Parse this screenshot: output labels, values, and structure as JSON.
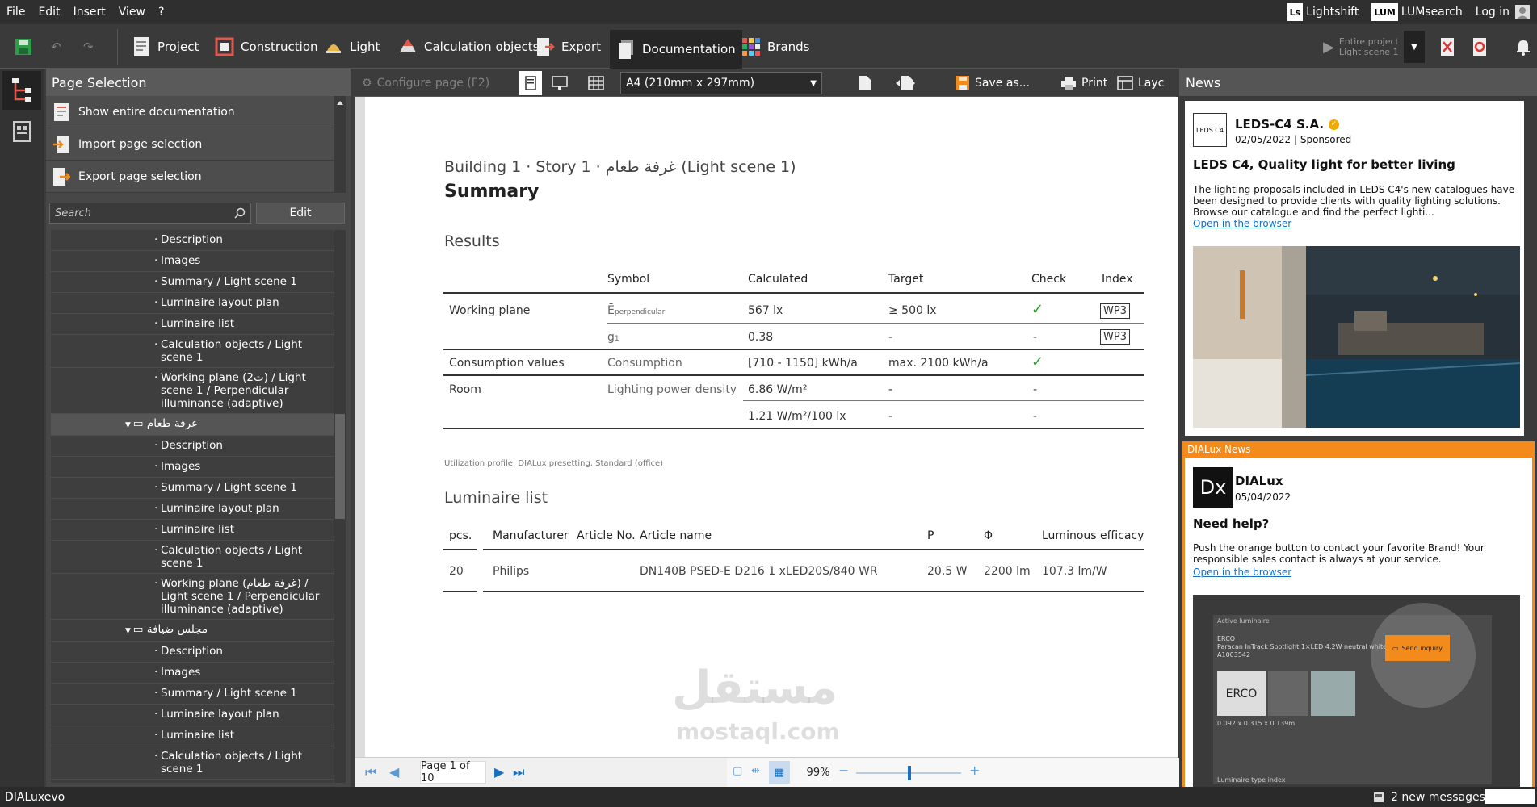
{
  "menu": [
    "File",
    "Edit",
    "Insert",
    "View",
    "?"
  ],
  "topright": {
    "lightshift_badge": "Ls",
    "lightshift": "Lightshift",
    "lumsearch_badge": "LUM",
    "lumsearch": "LUMsearch",
    "login": "Log in"
  },
  "toolbar": {
    "project": "Project",
    "construction": "Construction",
    "light": "Light",
    "calc_objects": "Calculation objects",
    "export": "Export",
    "documentation": "Documentation",
    "brands": "Brands",
    "entire_project_line1": "Entire project",
    "entire_project_line2": "Light scene 1"
  },
  "page_selection": {
    "title": "Page Selection",
    "show_entire": "Show entire documentation",
    "import": "Import page selection",
    "export": "Export page selection",
    "search_placeholder": "Search",
    "edit": "Edit"
  },
  "tree": [
    {
      "text": "Description",
      "kind": "leaf"
    },
    {
      "text": "Images",
      "kind": "leaf"
    },
    {
      "text": "Summary / Light scene 1",
      "kind": "leaf"
    },
    {
      "text": "Luminaire layout plan",
      "kind": "leaf"
    },
    {
      "text": "Luminaire list",
      "kind": "leaf"
    },
    {
      "text": "Calculation objects / Light scene 1",
      "kind": "leaf"
    },
    {
      "text": "Working plane (2ت) / Light scene 1 / Perpendicular illuminance (adaptive)",
      "kind": "leaf"
    },
    {
      "text": "غرفة طعام",
      "kind": "folder",
      "selected": true
    },
    {
      "text": "Description",
      "kind": "leaf"
    },
    {
      "text": "Images",
      "kind": "leaf"
    },
    {
      "text": "Summary / Light scene 1",
      "kind": "leaf"
    },
    {
      "text": "Luminaire layout plan",
      "kind": "leaf"
    },
    {
      "text": "Luminaire list",
      "kind": "leaf"
    },
    {
      "text": "Calculation objects / Light scene 1",
      "kind": "leaf"
    },
    {
      "text": "Working plane (غرفة طعام) / Light scene 1 / Perpendicular illuminance (adaptive)",
      "kind": "leaf"
    },
    {
      "text": "مجلس ضيافة",
      "kind": "folder"
    },
    {
      "text": "Description",
      "kind": "leaf"
    },
    {
      "text": "Images",
      "kind": "leaf"
    },
    {
      "text": "Summary / Light scene 1",
      "kind": "leaf"
    },
    {
      "text": "Luminaire layout plan",
      "kind": "leaf"
    },
    {
      "text": "Luminaire list",
      "kind": "leaf"
    },
    {
      "text": "Calculation objects / Light scene 1",
      "kind": "leaf"
    }
  ],
  "doc_toolbar": {
    "configure": "Configure page (F2)",
    "page_size": "A4 (210mm x 297mm)",
    "save_as": "Save as...",
    "print": "Print",
    "layout": "Layc"
  },
  "document": {
    "breadcrumb": "Building 1 · Story 1 · غرفة طعام (Light scene 1)",
    "title": "Summary",
    "results_heading": "Results",
    "results_headers": [
      "Symbol",
      "Calculated",
      "Target",
      "Check",
      "Index"
    ],
    "results": {
      "working_plane": "Working plane",
      "e_symbol": "Ē",
      "e_sub": "perpendicular",
      "e_calc": "567 lx",
      "e_target": "≥ 500 lx",
      "index1": "WP3",
      "g_symbol": "g",
      "g_sub": "1",
      "g_calc": "0.38",
      "g_target": "-",
      "g_check": "-",
      "index2": "WP3",
      "consumption": "Consumption values",
      "consumption_sym": "Consumption",
      "consumption_calc": "[710 - 1150] kWh/a",
      "consumption_target": "max. 2100 kWh/a",
      "room": "Room",
      "lpd": "Lighting power density",
      "lpd_calc1": "6.86 W/m²",
      "lpd_target1": "-",
      "lpd_check1": "-",
      "lpd_calc2": "1.21 W/m²/100 lx",
      "lpd_target2": "-",
      "lpd_check2": "-"
    },
    "utilization": "Utilization profile: DIALux presetting, Standard (office)",
    "luminaire_heading": "Luminaire list",
    "lum_headers": [
      "pcs.",
      "Manufacturer",
      "Article No.",
      "Article name",
      "P",
      "Φ",
      "Luminous efficacy"
    ],
    "lum_row": [
      "20",
      "Philips",
      "",
      "DN140B PSED-E D216 1 xLED20S/840 WR",
      "20.5 W",
      "2200 lm",
      "107.3 lm/W"
    ]
  },
  "pager": {
    "page_text": "Page 1 of 10",
    "zoom": "99%"
  },
  "news": {
    "title": "News",
    "card1": {
      "logo": "LEDS C4",
      "company": "LEDS-C4 S.A.",
      "date": "02/05/2022",
      "sponsored": "| Sponsored",
      "headline": "LEDS C4, Quality light for better living",
      "body": "The lighting proposals included in LEDS C4's new catalogues have been designed to provide clients with quality lighting solutions. Browse our catalogue and find the perfect lighti...",
      "link": "Open in the browser"
    },
    "dialux_bar": "DIALux News",
    "card2": {
      "logo": "Dx",
      "company": "DIALux",
      "date": "05/04/2022",
      "headline": "Need help?",
      "body": "Push the orange button to contact your favorite Brand! Your responsible sales contact is always at your service.",
      "link": "Open in the browser",
      "shot_header": "Active luminaire",
      "shot_brand": "ERCO",
      "shot_desc": "Paracan InTrack Spotlight 1×LED 4.2W neutral white",
      "shot_code": "A1003542",
      "shot_button": "Send inquiry",
      "shot_dims": "0.092 x 0.315 x 0.139m",
      "shot_footer": "Luminaire type index",
      "shot_logo": "ERCO"
    }
  },
  "status": {
    "app": "DIALux",
    "app_suffix": "evo",
    "messages": "2 new messages"
  },
  "watermark": {
    "arabic": "مستقل",
    "latin": "mostaql.com"
  }
}
